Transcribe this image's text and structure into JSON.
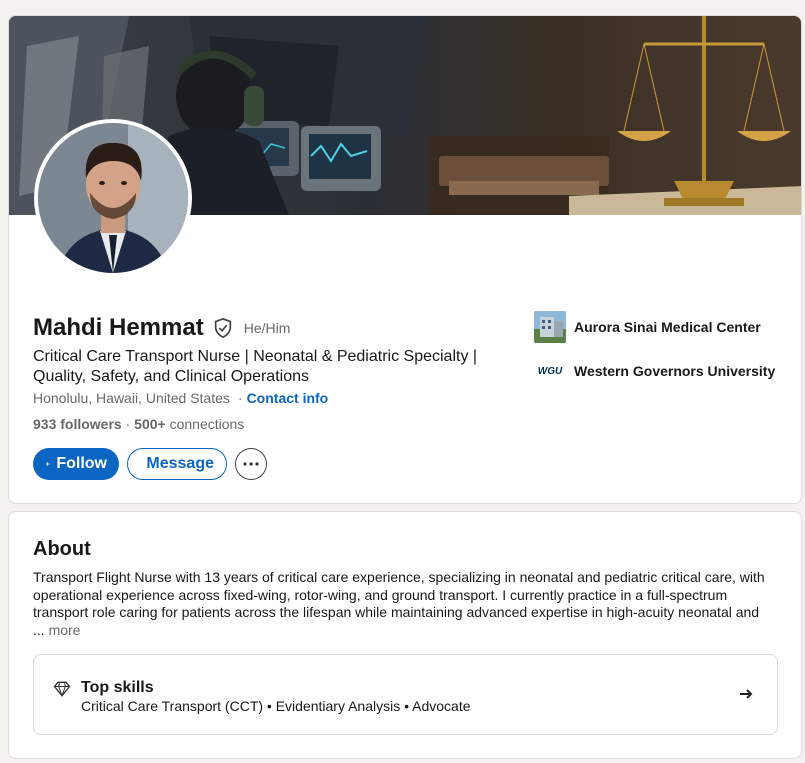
{
  "profile": {
    "name": "Mahdi Hemmat",
    "verified_icon": "shield-check-icon",
    "pronouns": "He/Him",
    "headline": "Critical Care Transport Nurse | Neonatal & Pediatric Specialty | Quality, Safety, and Clinical Operations",
    "location": "Honolulu, Hawaii, United States",
    "separator": "·",
    "contact_info": "Contact info",
    "followers": "933 followers",
    "dot": "·",
    "connections_count": "500+",
    "connections_label": "connections",
    "actions": {
      "follow": "Follow",
      "message": "Message"
    },
    "orgs": [
      {
        "name": "Aurora Sinai Medical Center",
        "logo": "hospital-building-logo"
      },
      {
        "name": "Western Governors University",
        "logo_text": "WGU"
      }
    ]
  },
  "about": {
    "title": "About",
    "text": "Transport Flight Nurse with 13 years of critical care experience, specializing in neonatal and pediatric critical care, with operational experience across fixed-wing, rotor-wing, and ground transport. I currently practice in a full-spectrum transport role caring for patients across the lifespan while maintaining advanced expertise in high-acuity neonatal and",
    "ellipsis": "...",
    "more": "more",
    "top_skills": {
      "icon": "diamond-icon",
      "title": "Top skills",
      "list": "Critical Care Transport (CCT) • Evidentiary Analysis • Advocate"
    }
  },
  "colors": {
    "accent": "#0a66c2",
    "page_bg": "#f4f2ee",
    "card_bg": "#ffffff"
  }
}
